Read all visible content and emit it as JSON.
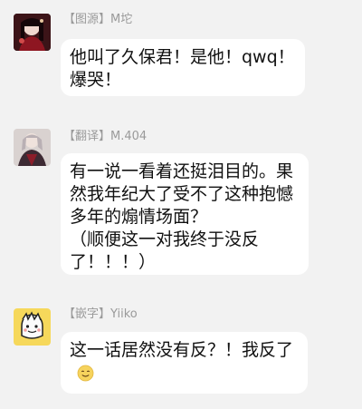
{
  "messages": [
    {
      "tag": "【图源】",
      "name": "M坨",
      "lines": [
        "他叫了久保君！是他！qwq！",
        "爆哭！"
      ]
    },
    {
      "tag": "【翻译】",
      "name": "M.404",
      "lines": [
        "有一说一看着还挺泪目的。果",
        "然我年纪大了受不了这种抱憾",
        "多年的煽情场面？",
        "（顺便这一对我终于没反",
        "了！！！）"
      ]
    },
    {
      "tag": "【嵌字】",
      "name": "Yiiko",
      "lines": [
        "这一话居然没有反？！我反了"
      ],
      "emoji": "smiling-face-emoji"
    }
  ]
}
